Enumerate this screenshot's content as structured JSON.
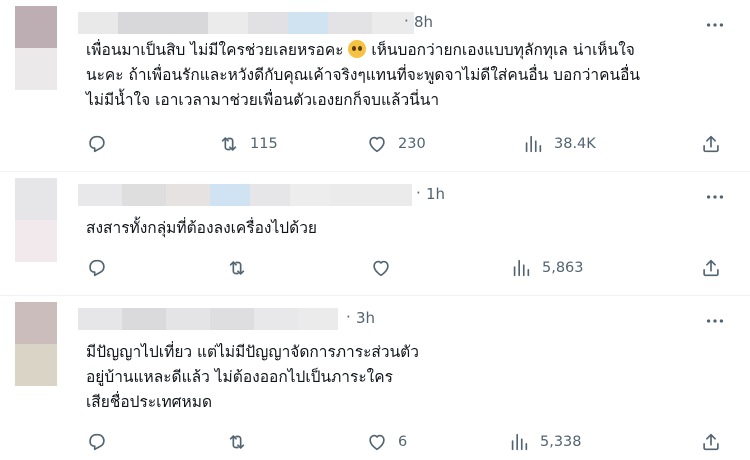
{
  "colors": {
    "text": "#0f1419",
    "muted": "#536471",
    "divider": "#eff3f4",
    "emoji": "#f5c242"
  },
  "tweets": [
    {
      "time": "8h",
      "lines": [
        "เพื่อนมาเป็นสิบ ไม่มีใครช่วยเลยหรอคะ",
        "นะคะ ถ้าเพื่อนรักและหวังดีกับคุณเค้าจริงๆแทนที่จะพูดจาไม่ดีใส่คนอื่น บอกว่าคนอื่น",
        "ไม่มีน้ำใจ เอาเวลามาช่วยเพื่อนตัวเองยกก็จบแล้วนี่นา"
      ],
      "line1_after_emoji": "เห็นบอกว่ายกเองแบบทุลักทุเล น่าเห็นใจ",
      "emoji": "pleading-face",
      "reply_count": "",
      "retweet_count": "115",
      "like_count": "230",
      "view_count": "38.4K"
    },
    {
      "time": "1h",
      "lines": [
        "สงสารทั้งกลุ่มที่ต้องลงเครื่องไปด้วย"
      ],
      "reply_count": "",
      "retweet_count": "",
      "like_count": "",
      "view_count": "5,863"
    },
    {
      "time": "3h",
      "lines": [
        "มีปัญญาไปเที่ยว แต่ไม่มีปัญญาจัดการภาระส่วนตัว",
        "อยู่บ้านแหละดีแล้ว ไม่ต้องออกไปเป็นภาระใคร",
        "เสียชื่อประเทศหมด"
      ],
      "reply_count": "",
      "retweet_count": "",
      "like_count": "6",
      "view_count": "5,338"
    }
  ],
  "icons": {
    "reply": "reply-icon",
    "retweet": "retweet-icon",
    "like": "heart-icon",
    "views": "views-icon",
    "share": "share-icon",
    "more": "more-icon"
  }
}
